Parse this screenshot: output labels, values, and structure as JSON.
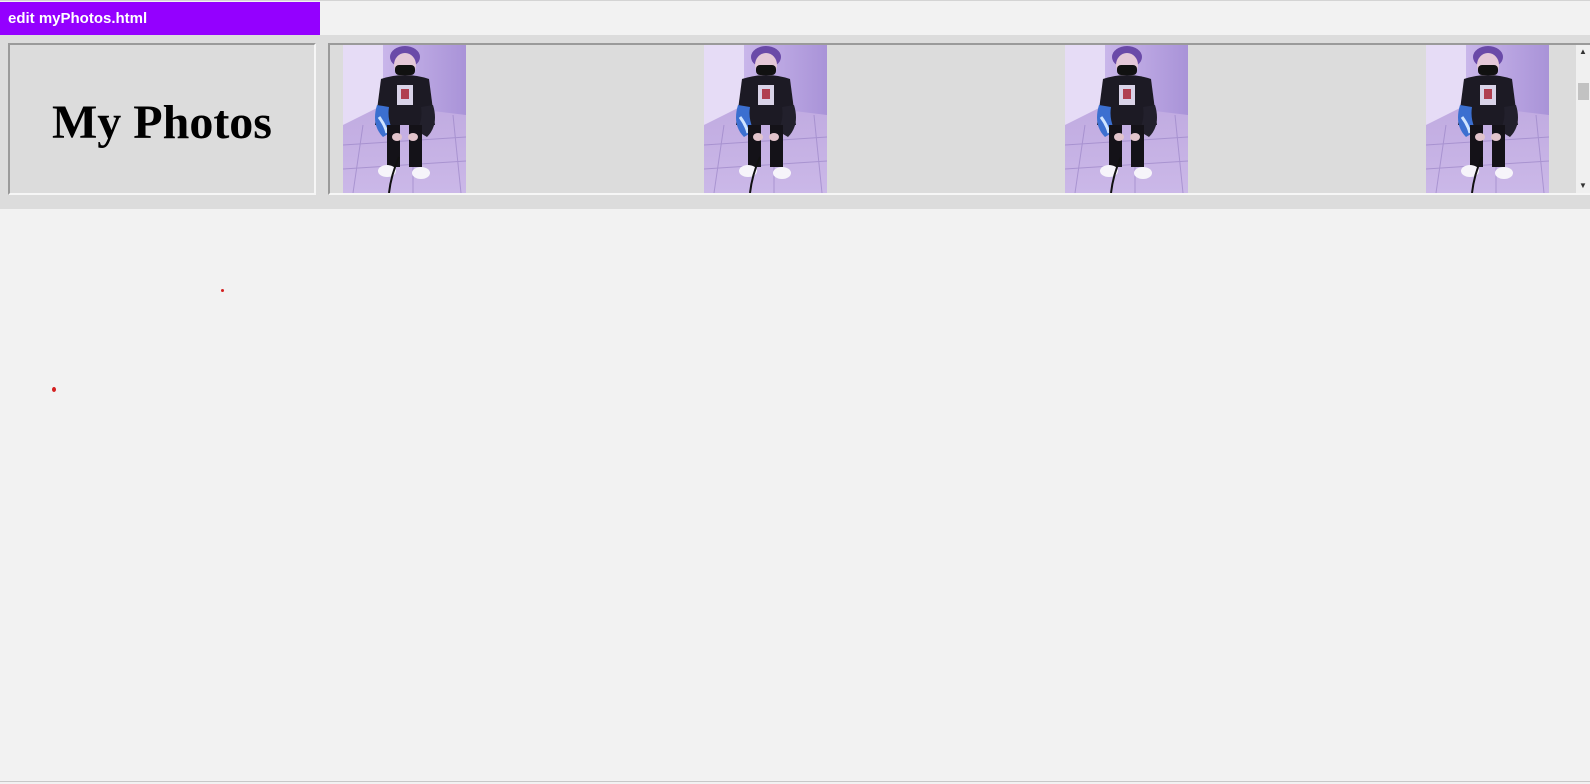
{
  "editor_tab": {
    "label": "edit myPhotos.html",
    "color": "#9400ff"
  },
  "page": {
    "title": "My Photos",
    "photo_count": 4,
    "photo_subject": "person-sitting-on-tiled-floor"
  },
  "colors": {
    "background": "#f2f2f2",
    "header_band": "#dcdcdc",
    "photo_tint": "#b8a4e0",
    "marker_red": "#d42020"
  },
  "scrollbar": {
    "up_icon": "triangle-up-icon",
    "down_icon": "triangle-down-icon"
  }
}
